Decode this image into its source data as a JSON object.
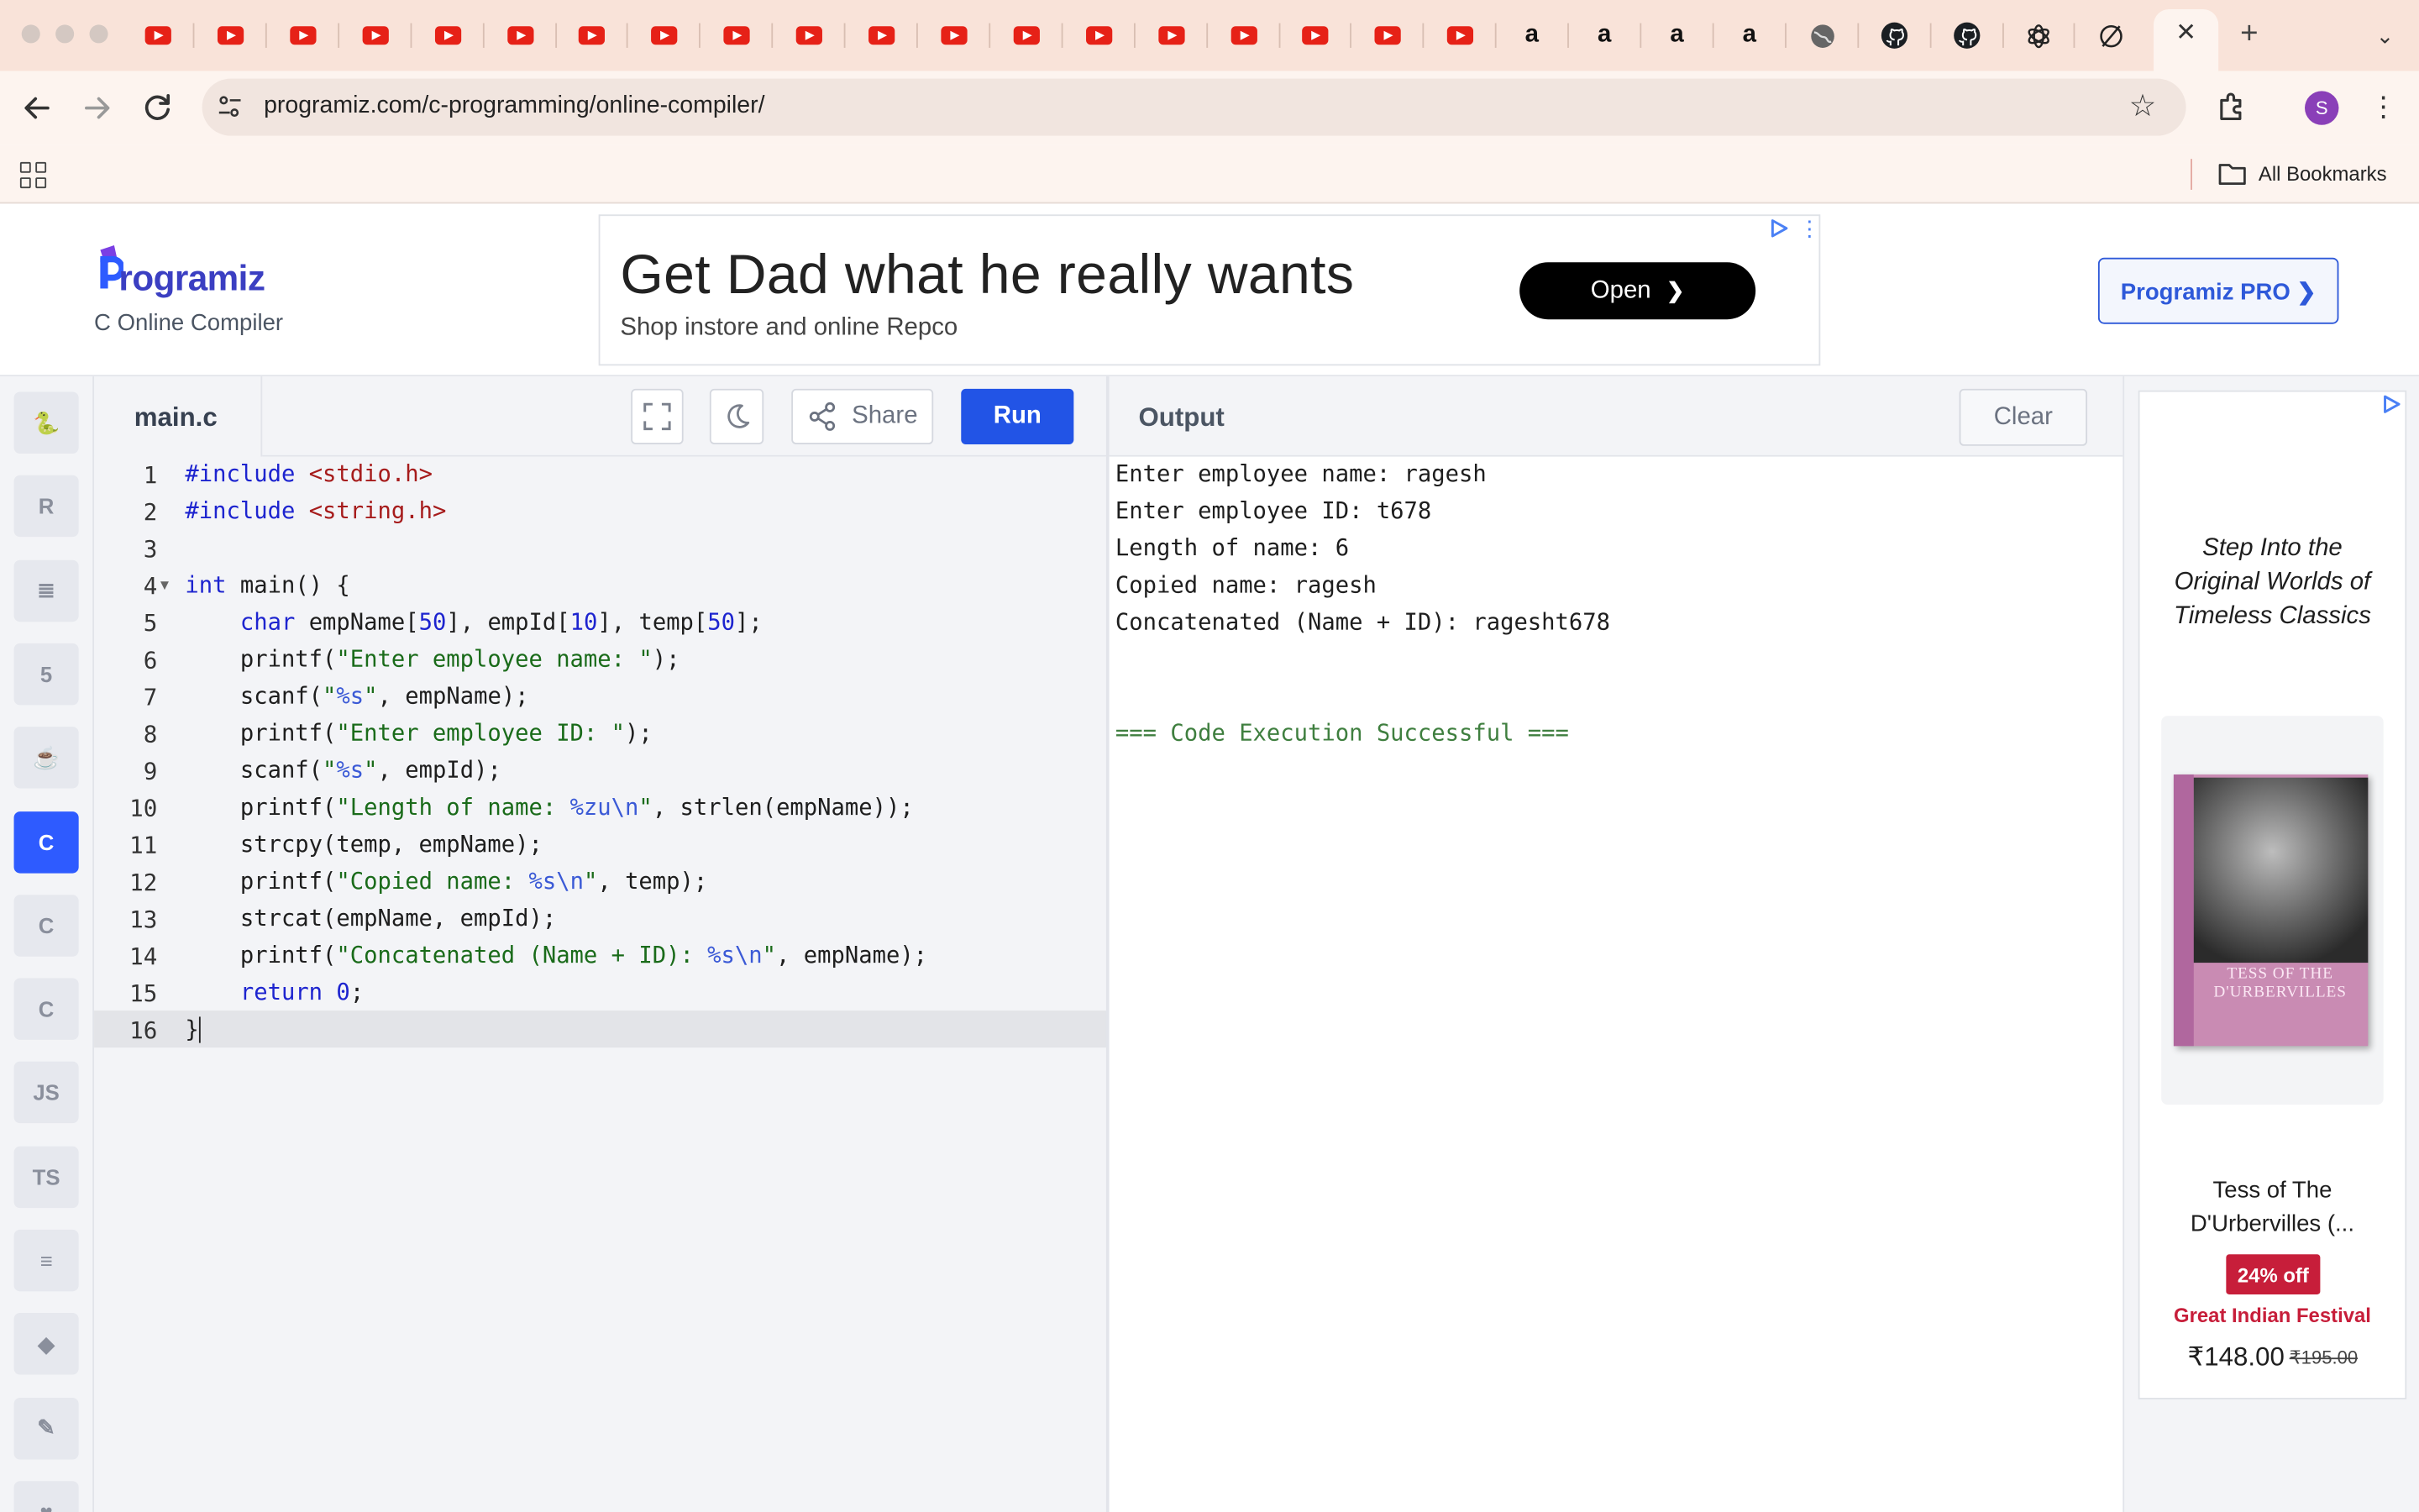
{
  "browser": {
    "tabs": {
      "youtube_count": 19,
      "amazon_count": 4,
      "icons": [
        "youtube-icon",
        "amazon-icon",
        "globe-icon",
        "github-icon",
        "github-icon",
        "openai-icon",
        "notion-icon"
      ],
      "amazon_glyph": "a",
      "close_glyph": "✕",
      "new_tab_glyph": "+",
      "menu_glyph": "⌄"
    },
    "url": "programiz.com/c-programming/online-compiler/",
    "avatar_letter": "S",
    "bookmarks_label": "All Bookmarks"
  },
  "header": {
    "logo_text": "rogramiz",
    "subtitle": "C Online Compiler",
    "ad_title": "Get Dad what he really wants",
    "ad_subtitle": "Shop instore and online Repco",
    "ad_button": "Open",
    "pro_button": "Programiz PRO ❯"
  },
  "rail": {
    "languages": [
      {
        "name": "python",
        "glyph": "🐍"
      },
      {
        "name": "r",
        "glyph": "R"
      },
      {
        "name": "sql",
        "glyph": "≣"
      },
      {
        "name": "html",
        "glyph": "5"
      },
      {
        "name": "java",
        "glyph": "☕"
      },
      {
        "name": "c",
        "glyph": "C"
      },
      {
        "name": "cpp",
        "glyph": "C"
      },
      {
        "name": "csharp",
        "glyph": "C"
      },
      {
        "name": "js",
        "glyph": "JS"
      },
      {
        "name": "ts",
        "glyph": "TS"
      },
      {
        "name": "go",
        "glyph": "≡"
      },
      {
        "name": "php",
        "glyph": "◆"
      },
      {
        "name": "swift",
        "glyph": "✎"
      },
      {
        "name": "rust",
        "glyph": "♥"
      }
    ],
    "active": "c"
  },
  "editor": {
    "file_name": "main.c",
    "share_label": "Share",
    "run_label": "Run",
    "lines": [
      "#include <stdio.h>",
      "#include <string.h>",
      "",
      "int main() {",
      "    char empName[50], empId[10], temp[50];",
      "    printf(\"Enter employee name: \");",
      "    scanf(\"%s\", empName);",
      "    printf(\"Enter employee ID: \");",
      "    scanf(\"%s\", empId);",
      "    printf(\"Length of name: %zu\\n\", strlen(empName));",
      "    strcpy(temp, empName);",
      "    printf(\"Copied name: %s\\n\", temp);",
      "    strcat(empName, empId);",
      "    printf(\"Concatenated (Name + ID): %s\\n\", empName);",
      "    return 0;",
      "}"
    ]
  },
  "output": {
    "title": "Output",
    "clear_label": "Clear",
    "lines": [
      "Enter employee name: ragesh",
      "Enter employee ID: t678",
      "Length of name: 6",
      "Copied name: ragesh",
      "Concatenated (Name + ID): ragesht678",
      "",
      "",
      "=== Code Execution Successful ==="
    ]
  },
  "side_ad": {
    "tagline": "Step Into the Original Worlds of Timeless Classics",
    "book_cover_title": "TESS OF THE D'URBERVILLES",
    "product_name": "Tess of The D'Urbervilles (...",
    "discount": "24% off",
    "festival": "Great Indian Festival",
    "price": "₹148.00",
    "old_price": "₹195.00"
  },
  "colors": {
    "tabstrip": "#f9e3d9",
    "run_button": "#2254e6",
    "active_lang": "#2e5bff",
    "discount_badge": "#c71e3a"
  }
}
